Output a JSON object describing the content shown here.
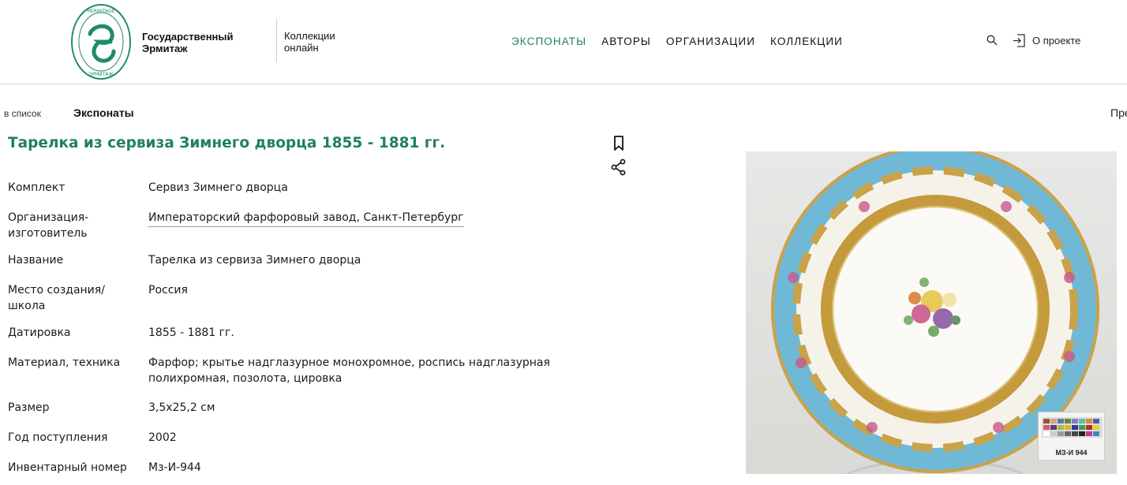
{
  "header": {
    "logo_icon": "hermitage-logo",
    "logo_text_top": "HERMITAGE",
    "logo_text_bottom": "ЭРМИТАЖ",
    "brand_line1": "Государственный",
    "brand_line2": "Эрмитаж",
    "sub_line1": "Коллекции",
    "sub_line2": "онлайн",
    "nav": [
      {
        "label": "ЭКСПОНАТЫ",
        "active": true
      },
      {
        "label": "АВТОРЫ",
        "active": false
      },
      {
        "label": "ОРГАНИЗАЦИИ",
        "active": false
      },
      {
        "label": "КОЛЛЕКЦИИ",
        "active": false
      }
    ],
    "search_icon": "search-icon",
    "login_icon": "login-icon",
    "about_label": "О проекте",
    "accent_color": "#1f7f66"
  },
  "breadcrumb": {
    "back_label": "в список",
    "current": "Экспонаты",
    "next_label": "Пре"
  },
  "item": {
    "title": "Тарелка из сервиза Зимнего дворца 1855 - 1881 гг.",
    "bookmark_icon": "bookmark-icon",
    "share_icon": "share-icon",
    "properties": [
      {
        "key": "Комплект",
        "value": "Сервиз Зимнего дворца",
        "link": false
      },
      {
        "key": "Организация-изготовитель",
        "value": "Императорский фарфоровый завод, Санкт-Петербург",
        "link": true
      },
      {
        "key": "Название",
        "value": "Тарелка из сервиза Зимнего дворца",
        "link": false
      },
      {
        "key": "Место создания/школа",
        "value": "Россия",
        "link": false
      },
      {
        "key": "Датировка",
        "value": "1855 - 1881 гг.",
        "link": false
      },
      {
        "key": "Материал, техника",
        "value": "Фарфор; крытье надглазурное монохромное, роспись надглазурная полихромная, позолота, цировка",
        "link": false
      },
      {
        "key": "Размер",
        "value": "3,5х25,2 см",
        "link": false
      },
      {
        "key": "Год поступления",
        "value": "2002",
        "link": false
      },
      {
        "key": "Инвентарный номер",
        "value": "Мз-И-944",
        "link": false
      }
    ],
    "photo_scale_label": "МЗ-И 944"
  }
}
